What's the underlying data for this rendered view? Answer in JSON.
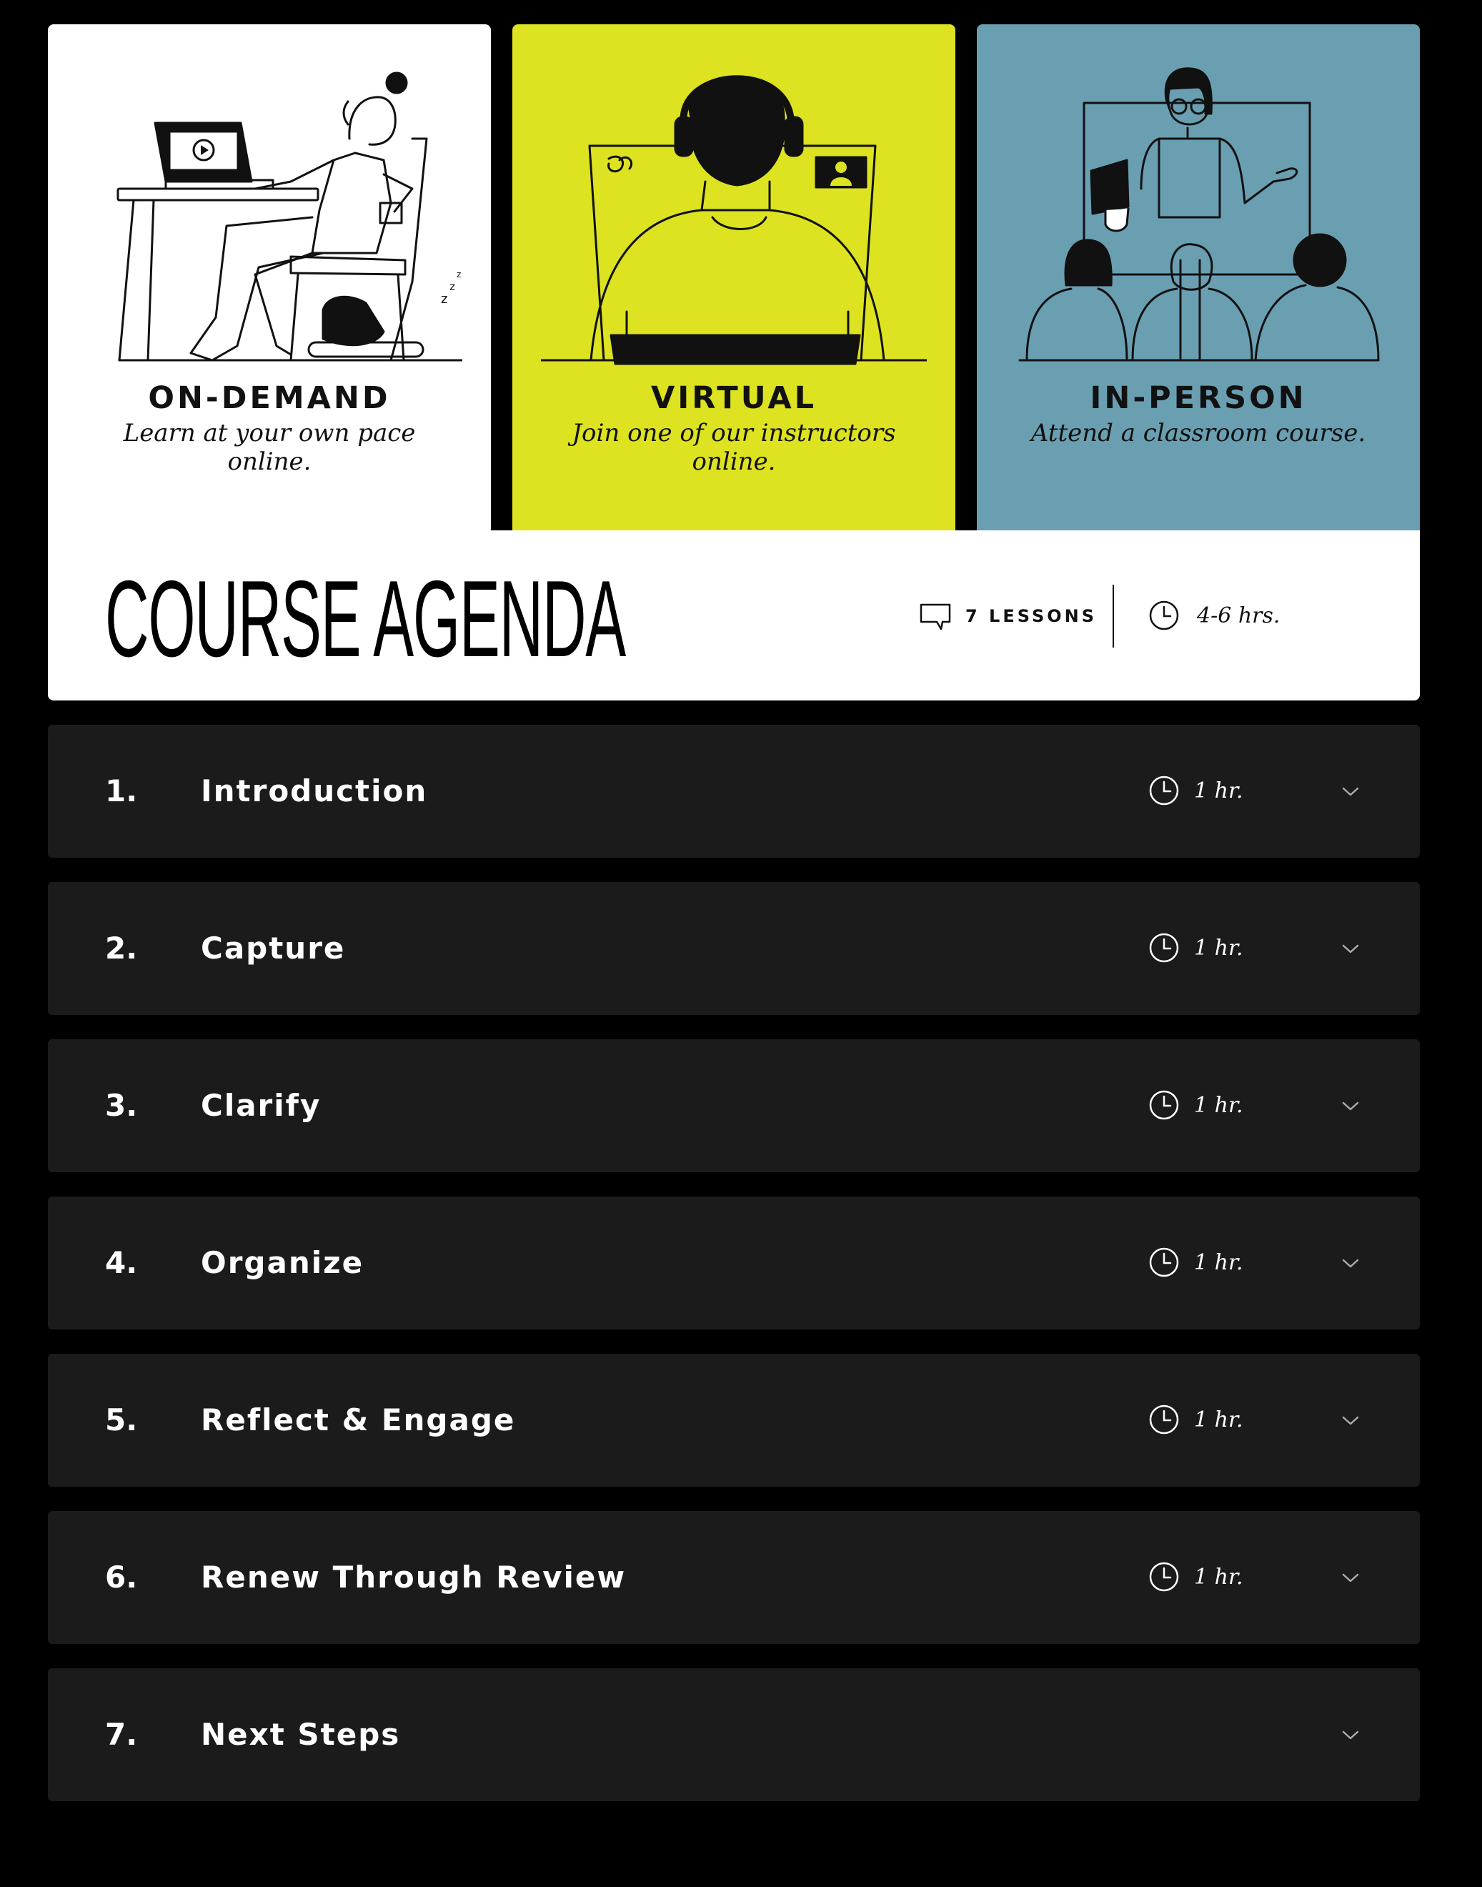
{
  "delivery_options": [
    {
      "title": "ON-DEMAND",
      "description": "Learn at your own pace online."
    },
    {
      "title": "VIRTUAL",
      "description": "Join one of our instructors online."
    },
    {
      "title": "IN-PERSON",
      "description": "Attend a classroom course."
    }
  ],
  "agenda": {
    "title": "COURSE AGENDA",
    "lessons_count": "7 LESSONS",
    "total_duration": "4-6 hrs.",
    "lessons_icon": "speech-bubble-icon",
    "clock_icon": "clock-icon"
  },
  "lessons": [
    {
      "number": "1.",
      "title": "Introduction",
      "duration": "1 hr."
    },
    {
      "number": "2.",
      "title": "Capture",
      "duration": "1 hr."
    },
    {
      "number": "3.",
      "title": "Clarify",
      "duration": "1 hr."
    },
    {
      "number": "4.",
      "title": "Organize",
      "duration": "1 hr."
    },
    {
      "number": "5.",
      "title": "Reflect & Engage",
      "duration": "1 hr."
    },
    {
      "number": "6.",
      "title": "Renew Through Review",
      "duration": "1 hr."
    },
    {
      "number": "7.",
      "title": "Next Steps",
      "duration": ""
    }
  ],
  "colors": {
    "page_background": "#000000",
    "on_demand_card": "#ffffff",
    "virtual_card": "#dde221",
    "in_person_card": "#6a9fb2",
    "lesson_row": "#1b1b1b",
    "text_light": "#ffffff",
    "text_dark": "#111111"
  }
}
